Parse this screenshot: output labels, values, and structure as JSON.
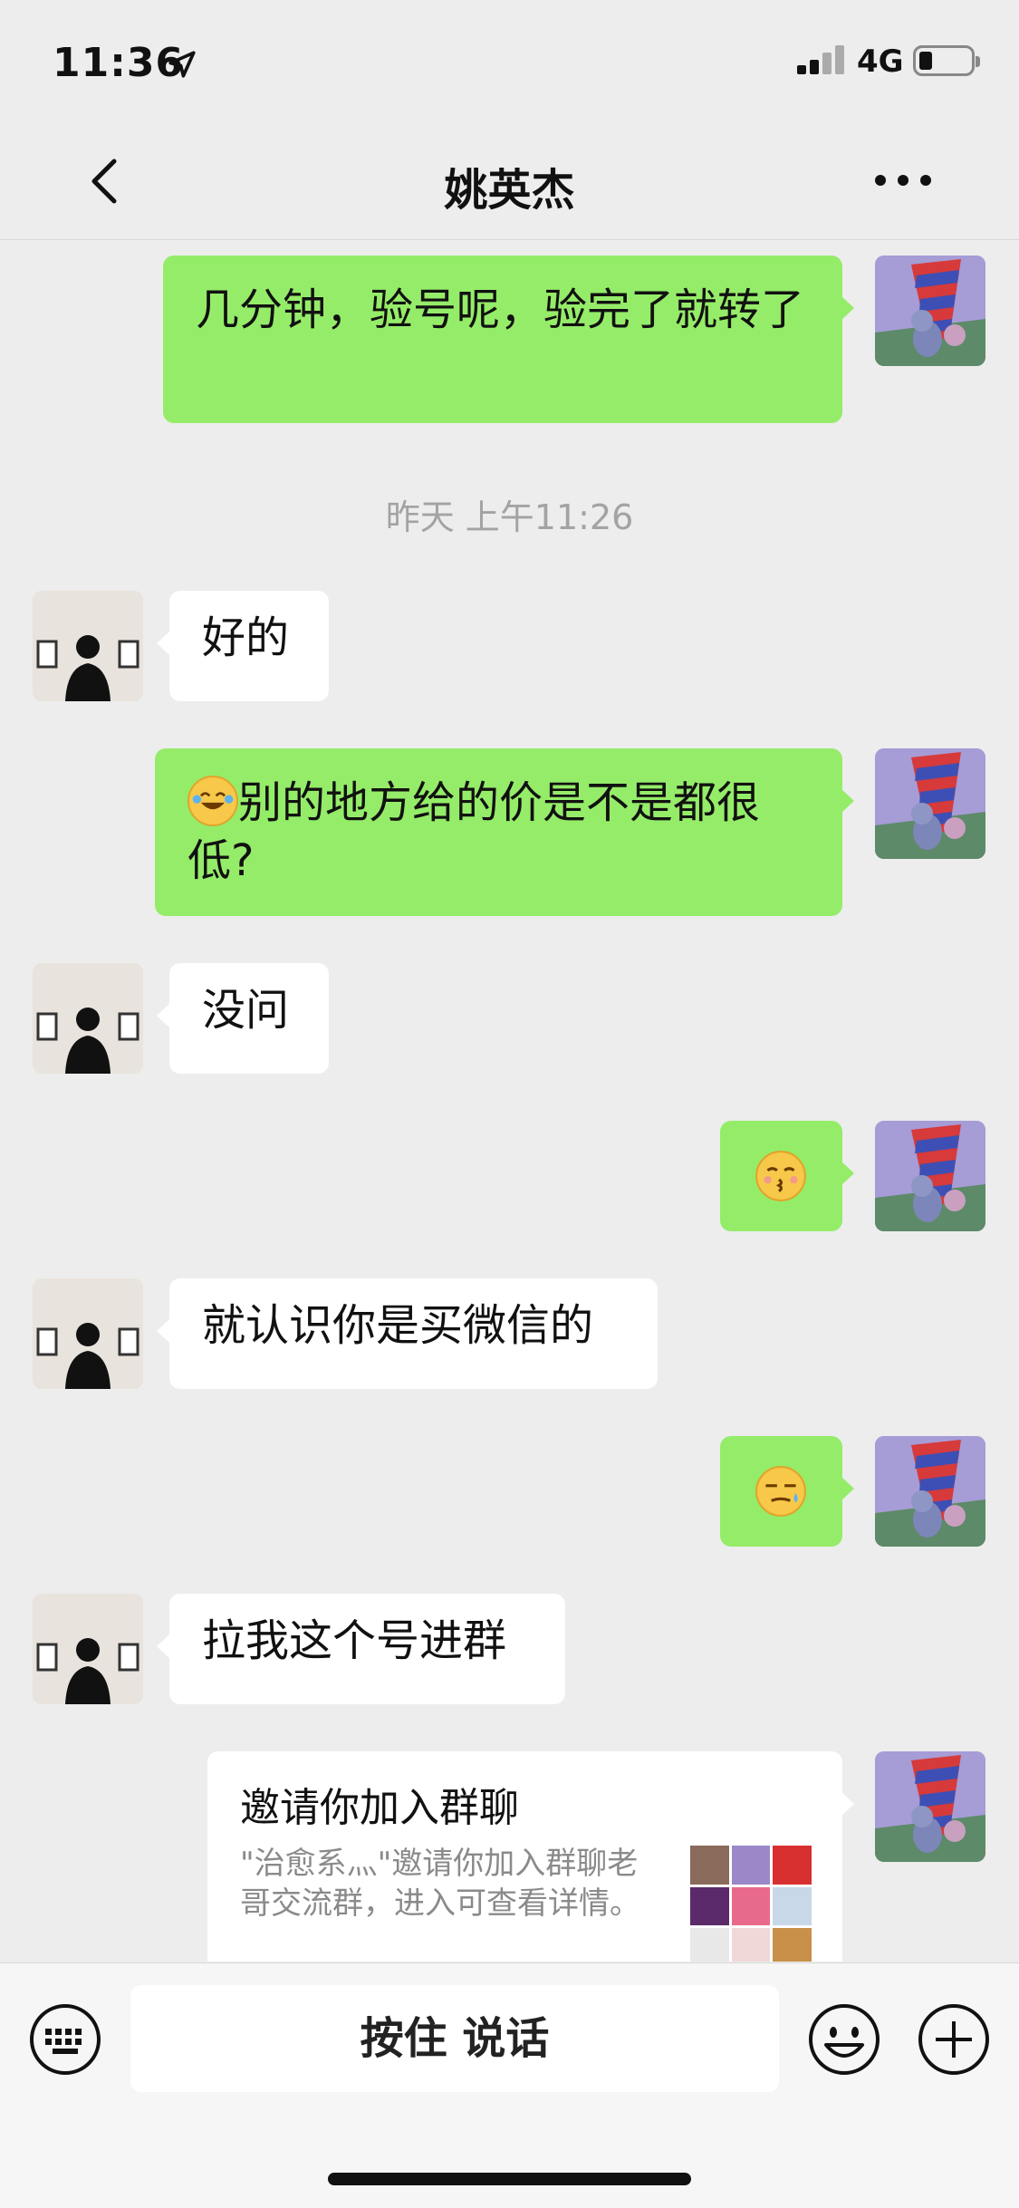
{
  "status_bar": {
    "time": "11:36",
    "network": "4G",
    "battery_level": 0.25
  },
  "header": {
    "title": "姚英杰"
  },
  "messages": [
    {
      "from": "me",
      "text": "几分钟，验号呢，验完了就转了"
    },
    {
      "type": "timestamp",
      "text": "昨天 上午11:26"
    },
    {
      "from": "them",
      "text": "好的"
    },
    {
      "from": "me",
      "emoji": "face-with-tears-of-joy",
      "text": "别的地方给的价是不是都很低?"
    },
    {
      "from": "them",
      "text": "没问"
    },
    {
      "from": "me",
      "emoji": "kissing-face-emoji"
    },
    {
      "from": "them",
      "text": "就认识你是买微信的"
    },
    {
      "from": "me",
      "emoji": "smirk-sweat-emoji"
    },
    {
      "from": "them",
      "text": "拉我这个号进群"
    },
    {
      "from": "me",
      "type": "invite_card",
      "card_title": "邀请你加入群聊",
      "card_desc": "\"治愈系灬\"邀请你加入群聊老哥交流群，进入可查看详情。"
    }
  ],
  "input_bar": {
    "voice_label": "按住 说话"
  },
  "colors": {
    "my_bubble": "#95ec69",
    "their_bubble": "#ffffff",
    "background": "#ededed"
  }
}
